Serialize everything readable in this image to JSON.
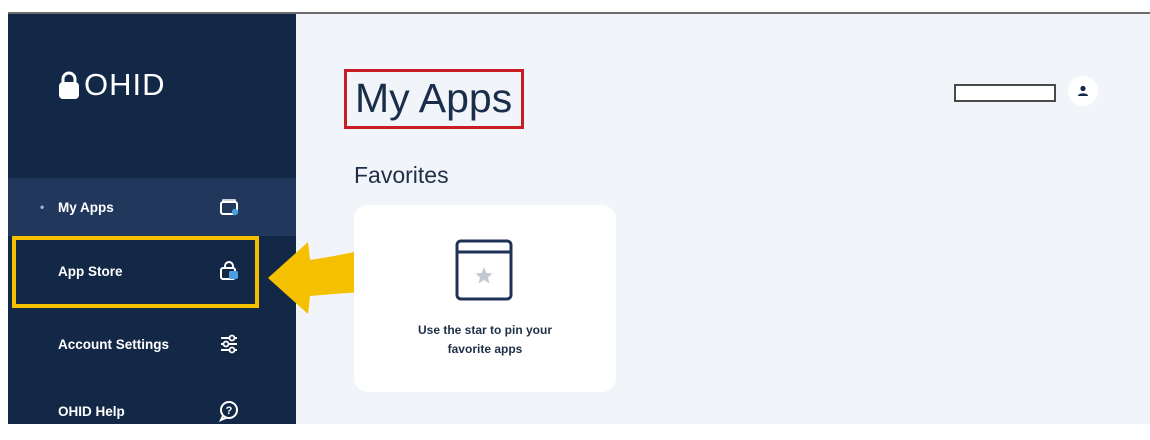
{
  "brand": {
    "name": "OHID"
  },
  "header": {
    "page_title": "My Apps",
    "user_name_field": ""
  },
  "sidebar": {
    "items": [
      {
        "label": "My Apps",
        "active": true,
        "icon": "wallet-icon"
      },
      {
        "label": "App Store",
        "active": false,
        "icon": "store-bag-icon"
      },
      {
        "label": "Account Settings",
        "active": false,
        "icon": "sliders-icon"
      },
      {
        "label": "OHID Help",
        "active": false,
        "icon": "help-chat-icon"
      }
    ]
  },
  "main": {
    "section_title": "Favorites",
    "favorites_empty": {
      "line1": "Use the star to pin your",
      "line2": "favorite apps",
      "icon": "star-window-icon"
    }
  },
  "annotations": {
    "title_box_color": "#c81d25",
    "highlight_color": "#f5c000",
    "pointer": "arrow-left"
  },
  "colors": {
    "sidebar_bg": "#132746",
    "sidebar_active_bg": "#21385c",
    "main_bg": "#f1f4f8",
    "text_dark": "#1f2f47"
  }
}
